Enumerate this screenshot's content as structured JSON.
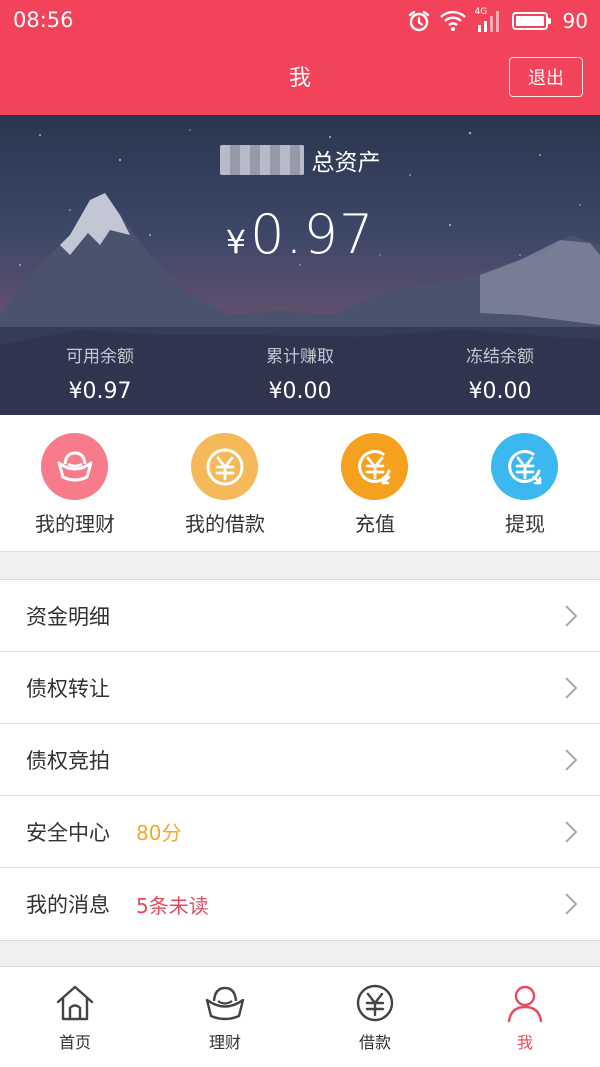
{
  "status_bar": {
    "time": "08:56",
    "network": "4G",
    "battery": "90"
  },
  "header": {
    "title": "我",
    "logout_label": "退出"
  },
  "assets": {
    "owner_suffix": "总资产",
    "currency": "¥",
    "total": "0.97",
    "stats": [
      {
        "label": "可用余额",
        "value": "¥0.97"
      },
      {
        "label": "累计赚取",
        "value": "¥0.00"
      },
      {
        "label": "冻结余额",
        "value": "¥0.00"
      }
    ]
  },
  "quick_actions": [
    {
      "label": "我的理财",
      "icon": "ingot-icon",
      "color": "#f77b8b"
    },
    {
      "label": "我的借款",
      "icon": "yen-coin-icon",
      "color": "#f5b95a"
    },
    {
      "label": "充值",
      "icon": "yen-recharge-icon",
      "color": "#f6a020"
    },
    {
      "label": "提现",
      "icon": "yen-withdraw-icon",
      "color": "#3bb8f0"
    }
  ],
  "menu": [
    {
      "title": "资金明细",
      "badge": ""
    },
    {
      "title": "债权转让",
      "badge": ""
    },
    {
      "title": "债权竞拍",
      "badge": ""
    },
    {
      "title": "安全中心",
      "badge": "80分",
      "badge_color": "#f0a92e"
    },
    {
      "title": "我的消息",
      "badge": "5条未读",
      "badge_color": "#e84a5f"
    }
  ],
  "tabs": [
    {
      "label": "首页",
      "icon": "home-icon"
    },
    {
      "label": "理财",
      "icon": "ingot-icon"
    },
    {
      "label": "借款",
      "icon": "yen-coin-icon"
    },
    {
      "label": "我",
      "icon": "person-icon",
      "active": true
    }
  ],
  "colors": {
    "primary": "#f2435a",
    "active_tab": "#e84a5f",
    "score": "#f0a92e",
    "unread": "#e84a5f"
  }
}
